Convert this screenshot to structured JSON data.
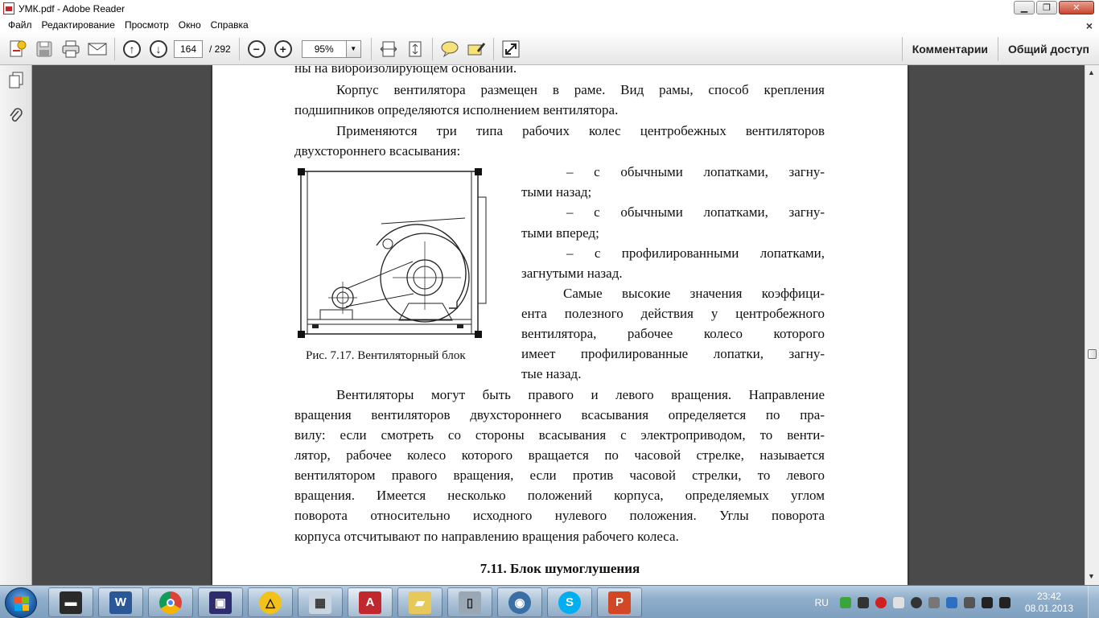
{
  "window": {
    "title": "УМК.pdf - Adobe Reader"
  },
  "menu": [
    "Файл",
    "Редактирование",
    "Просмотр",
    "Окно",
    "Справка"
  ],
  "toolbar": {
    "page_current": "164",
    "page_total": "/ 292",
    "zoom": "95%",
    "comments_label": "Комментарии",
    "share_label": "Общий доступ"
  },
  "document": {
    "lines": [
      "ны на виброизолирующем основании.",
      "Корпус вентилятора размещен в раме. Вид рамы, способ крепления",
      "подшипников определяются исполнением вентилятора.",
      "Применяются три типа рабочих колес центробежных вентиляторов",
      "двухстороннего всасывания:",
      "–   с обычными лопатками, загну-",
      "тыми назад;",
      "–   с обычными лопатками, загну-",
      "тыми вперед;",
      "–   с профилированными лопатками,",
      "загнутыми назад.",
      "Самые высокие значения коэффици-",
      "ента полезного действия у центробежного",
      "вентилятора, рабочее колесо которого",
      "имеет профилированные лопатки, загну-",
      "тые назад.",
      "Вентиляторы могут быть правого и левого вращения. Направление",
      "вращения вентиляторов двухстороннего всасывания определяется по пра-",
      "вилу: если смотреть со стороны всасывания с электроприводом, то венти-",
      "лятор, рабочее колесо которого вращается по часовой стрелке, называется",
      "вентилятором правого вращения, если против часовой стрелки, то левого",
      "вращения. Имеется несколько положений корпуса, определяемых углом",
      "поворота относительно исходного нулевого положения. Углы поворота",
      "корпуса отсчитывают по направлению вращения рабочего колеса."
    ],
    "figure_caption": "Рис. 7.17. Вентиляторный блок",
    "section_heading": "7.11. Блок шумоглушения"
  },
  "taskbar": {
    "language": "RU",
    "time": "23:42",
    "date": "08.01.2013",
    "apps": [
      "printer-app",
      "word",
      "chrome",
      "save-app",
      "triangle-app",
      "calculator",
      "acrobat",
      "folder-app",
      "phone-app",
      "media-app",
      "skype",
      "powerpoint"
    ]
  },
  "colors": {
    "doc_bg": "#4a4a4a",
    "taskbar": "#8faecb",
    "acrobat_red": "#c0282d"
  }
}
